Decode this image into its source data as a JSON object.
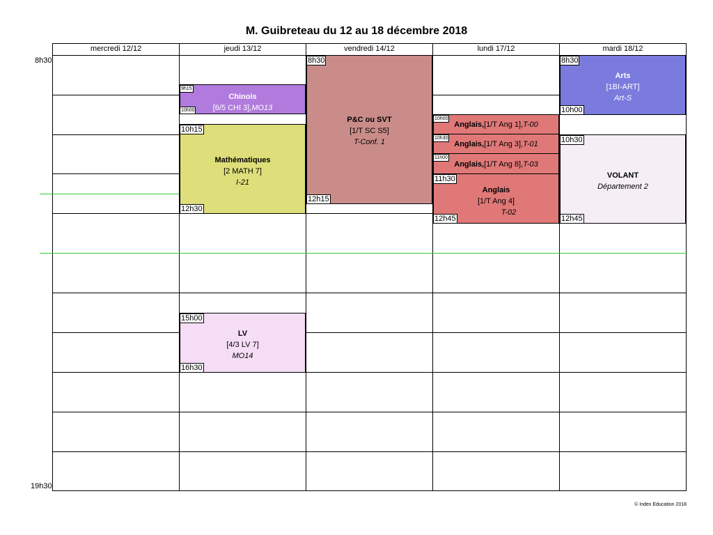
{
  "title": "M. Guibreteau du 12 au 18 décembre 2018",
  "days": [
    "mercredi 12/12",
    "jeudi 13/12",
    "vendredi 14/12",
    "lundi 17/12",
    "mardi 18/12"
  ],
  "time_labels": {
    "start": "8h30",
    "end": "19h30"
  },
  "events": {
    "chinois": {
      "subject": "Chinois",
      "group": "[6/5 CHI 3],",
      "room": "MO13",
      "start": "9h15",
      "end": "10h00",
      "color": "#b07bdc"
    },
    "maths": {
      "subject": "Mathématiques",
      "group": "[2 MATH 7]",
      "room": "I-21",
      "start": "10h15",
      "end": "12h30",
      "color": "#dede7a"
    },
    "lv": {
      "subject": "LV",
      "group": "[4/3 LV 7]",
      "room": "MO14",
      "start": "15h00",
      "end": "16h30",
      "color": "#f5ddf5"
    },
    "pcsvt": {
      "subject": "P&C ou SVT",
      "group": "[1/T SC S5]",
      "room": "T-Conf. 1",
      "start": "8h30",
      "end": "12h15",
      "color": "#c98c89"
    },
    "anglais1": {
      "subject": "Anglais,",
      "group": "[1/T Ang 1],",
      "room": "T-00",
      "start": "10h00"
    },
    "anglais2": {
      "subject": "Anglais,",
      "group": "[1/T Ang 3],",
      "room": "T-01",
      "start": "10h30"
    },
    "anglais3": {
      "subject": "Anglais,",
      "group": "[1/T Ang 8],",
      "room": "T-03",
      "start": "11h00"
    },
    "anglais4": {
      "subject": "Anglais",
      "group": "[1/T Ang 4]",
      "room": "T-02",
      "start": "11h30",
      "end": "12h45"
    },
    "arts": {
      "subject": "Arts",
      "group": "[1BI-ART]",
      "room": "Art-S",
      "start": "8h30",
      "end": "10h00",
      "color": "#7b7bde"
    },
    "volant": {
      "subject": "VOLANT",
      "room": "Département 2",
      "start": "10h30",
      "end": "12h45",
      "color": "#f5eff5"
    }
  },
  "anglais_color": "#e07878",
  "footer": "© Index Education 2018"
}
